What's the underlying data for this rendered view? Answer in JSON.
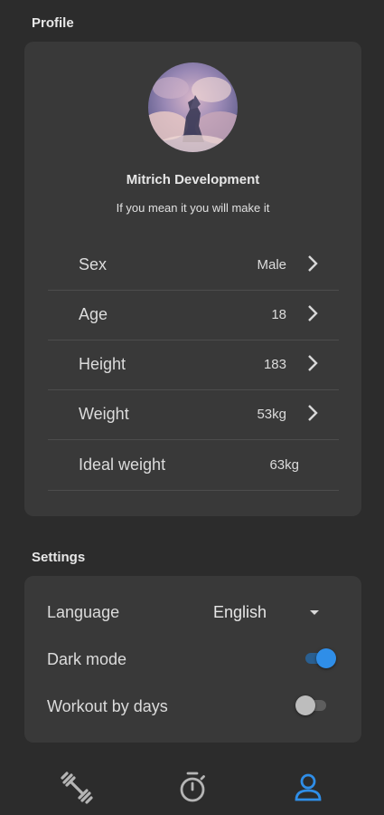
{
  "profile": {
    "section_title": "Profile",
    "name": "Mitrich Development",
    "motto": "If you mean it you will make it",
    "rows": [
      {
        "label": "Sex",
        "value": "Male"
      },
      {
        "label": "Age",
        "value": "18"
      },
      {
        "label": "Height",
        "value": "183"
      },
      {
        "label": "Weight",
        "value": "53kg"
      },
      {
        "label": "Ideal weight",
        "value": "63kg"
      }
    ]
  },
  "settings": {
    "section_title": "Settings",
    "language_label": "Language",
    "language_value": "English",
    "dark_mode_label": "Dark mode",
    "dark_mode_on": true,
    "workout_by_days_label": "Workout by days",
    "workout_by_days_on": false
  },
  "nav": {
    "items": [
      {
        "icon": "dumbbell-icon",
        "active": false
      },
      {
        "icon": "stopwatch-icon",
        "active": false
      },
      {
        "icon": "person-icon",
        "active": true
      }
    ]
  },
  "colors": {
    "background": "#2c2c2c",
    "card": "#393939",
    "accent": "#2f8ee8",
    "text": "#dcdcdc",
    "icon": "#b5b5b5"
  }
}
